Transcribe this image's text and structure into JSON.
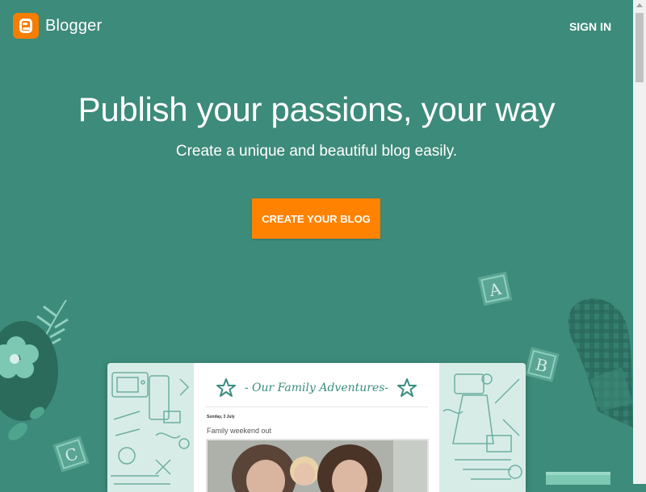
{
  "header": {
    "brand": "Blogger",
    "sign_in_label": "SIGN IN"
  },
  "hero": {
    "title": "Publish your passions, your way",
    "subtitle": "Create a unique and beautiful blog easily.",
    "cta_label": "CREATE YOUR BLOG"
  },
  "preview": {
    "blog_title": "- Our Family Adventures-",
    "post_date": "Sunday, 3 July",
    "post_title": "Family weekend out"
  },
  "colors": {
    "background": "#3d8b7a",
    "accent": "#ff8200",
    "logo": "#f57d00"
  },
  "icons": {
    "logo": "blogger-logo-icon",
    "star": "star-icon",
    "block_a": "letter-block-a-icon",
    "block_b": "letter-block-b-icon",
    "block_c": "letter-block-c-icon",
    "flower": "flower-icon",
    "leaf": "leaf-icon",
    "mitten": "oven-mitt-icon"
  }
}
